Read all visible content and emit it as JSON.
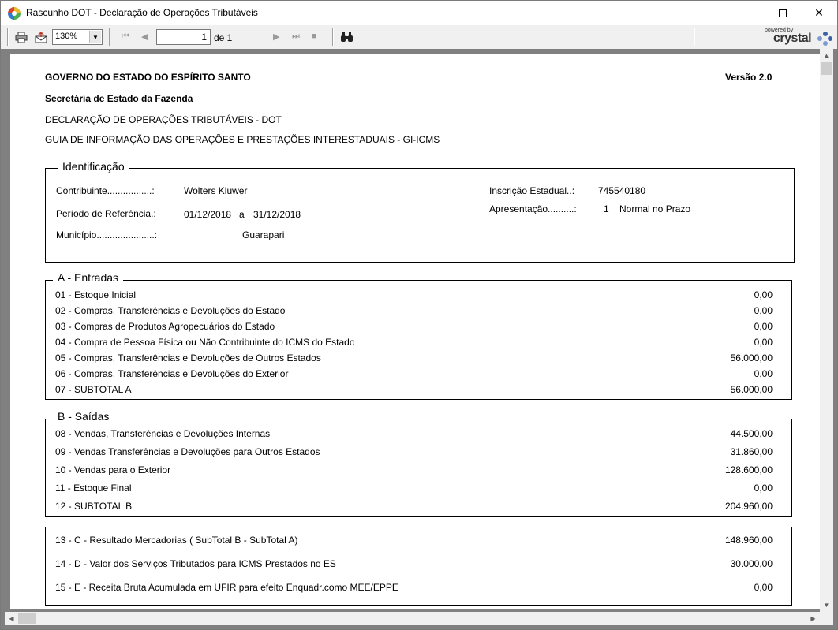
{
  "window": {
    "title": "Rascunho DOT - Declaração de Operações Tributáveis"
  },
  "toolbar": {
    "zoom": "130%",
    "page_current": "1",
    "page_of": "de 1",
    "logo_powered": "powered by",
    "logo_word": "crystal"
  },
  "header": {
    "gov": "GOVERNO DO ESTADO DO ESPÍRITO SANTO",
    "version": "Versão 2.0",
    "secretaria": "Secretária de Estado da Fazenda",
    "dot": "DECLARAÇÃO DE OPERAÇÕES TRIBUTÁVEIS - DOT",
    "gi": "GUIA DE INFORMAÇÃO DAS OPERAÇÕES E PRESTAÇÕES INTERESTADUAIS  - GI-ICMS"
  },
  "identificacao": {
    "legend": "Identificação",
    "contribuinte_label": "Contribuinte.................:",
    "contribuinte_value": "Wolters Kluwer",
    "periodo_label": "Período de Referência.:",
    "periodo_start": "01/12/2018",
    "periodo_sep": "a",
    "periodo_end": "31/12/2018",
    "municipio_label": "Município......................:",
    "municipio_value": "Guarapari",
    "inscricao_label": "Inscrição Estadual..:",
    "inscricao_value": "745540180",
    "apresentacao_label": "Apresentação..........:",
    "apresentacao_code": "1",
    "apresentacao_value": "Normal no Prazo"
  },
  "entradas": {
    "legend": "A - Entradas",
    "rows": [
      {
        "label": "01 - Estoque Inicial",
        "value": "0,00"
      },
      {
        "label": "02 - Compras, Transferências e Devoluções do Estado",
        "value": "0,00"
      },
      {
        "label": "03 - Compras de Produtos Agropecuários do Estado",
        "value": "0,00"
      },
      {
        "label": "04 - Compra de Pessoa Física ou Não Contribuinte do ICMS do Estado",
        "value": "0,00"
      },
      {
        "label": "05 - Compras, Transferências e Devoluções de Outros Estados",
        "value": "56.000,00"
      },
      {
        "label": "06 - Compras, Transferências e Devoluções do Exterior",
        "value": "0,00"
      },
      {
        "label": "07 - SUBTOTAL A",
        "value": "56.000,00"
      }
    ]
  },
  "saidas": {
    "legend": "B - Saídas",
    "rows": [
      {
        "label": "08 - Vendas, Transferências e Devoluções Internas",
        "value": "44.500,00"
      },
      {
        "label": "09 - Vendas Transferências e Devoluções para Outros Estados",
        "value": "31.860,00"
      },
      {
        "label": "10 - Vendas para o Exterior",
        "value": "128.600,00"
      },
      {
        "label": "11 - Estoque Final",
        "value": "0,00"
      },
      {
        "label": "12 - SUBTOTAL B",
        "value": "204.960,00"
      }
    ]
  },
  "resultados": {
    "rows": [
      {
        "label": "13 - C - Resultado Mercadorias ( SubTotal B - SubTotal A)",
        "value": "148.960,00"
      },
      {
        "label": "14 - D - Valor dos Serviços Tributados para ICMS Prestados no ES",
        "value": "30.000,00"
      },
      {
        "label": "15 - E - Receita Bruta Acumulada em UFIR para efeito Enquadr.como MEE/EPPE",
        "value": "0,00"
      }
    ]
  }
}
